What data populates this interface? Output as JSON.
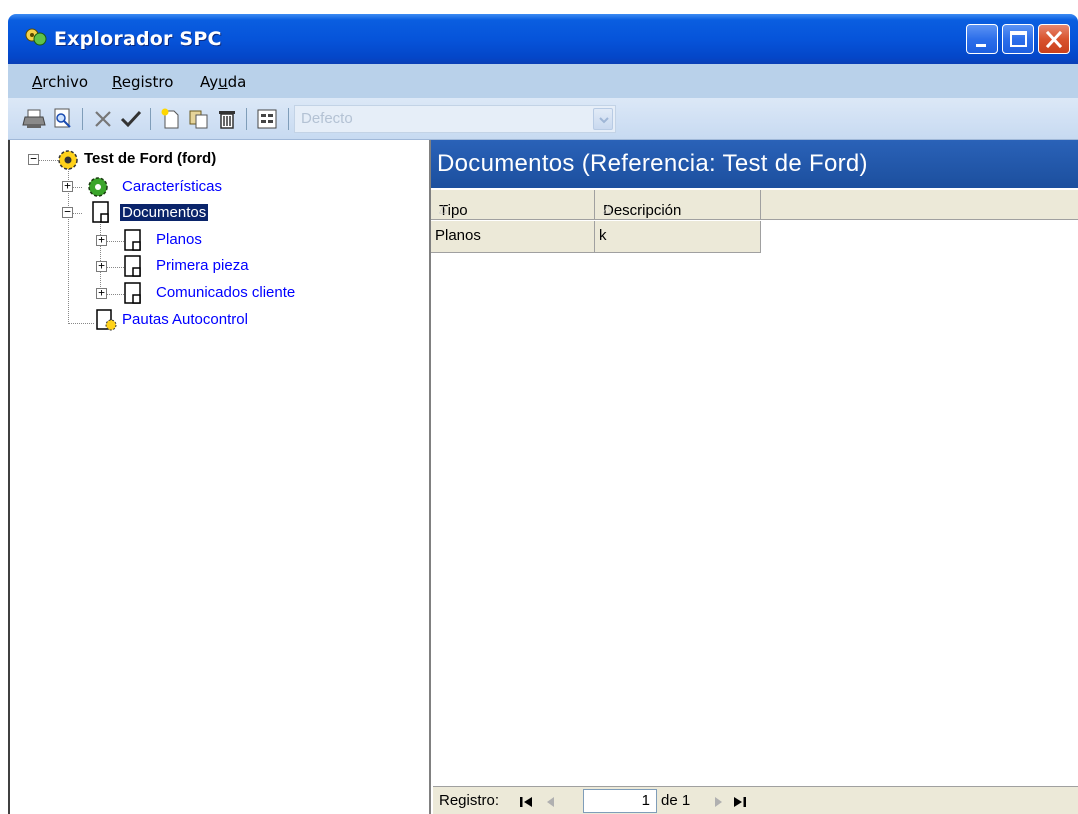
{
  "window": {
    "title": "Explorador SPC",
    "controls": [
      "minimize-icon",
      "maximize-icon",
      "close-icon"
    ]
  },
  "menu": {
    "items": [
      {
        "pre": "",
        "u": "A",
        "post": "rchivo"
      },
      {
        "pre": "",
        "u": "R",
        "post": "egistro"
      },
      {
        "pre": "Ay",
        "u": "u",
        "post": "da"
      }
    ]
  },
  "toolbar": {
    "buttons": [
      "print-icon",
      "print-preview-icon",
      "cancel-icon",
      "accept-icon",
      "new-icon",
      "copy-icon",
      "delete-icon",
      "form-view-icon"
    ],
    "combo": {
      "value": "Defecto"
    }
  },
  "tree": {
    "root": {
      "label": "Test de Ford (ford)"
    },
    "children": [
      {
        "label": "Características"
      },
      {
        "label": "Documentos"
      },
      {
        "label": "Planos"
      },
      {
        "label": "Primera pieza"
      },
      {
        "label": "Comunicados cliente"
      },
      {
        "label": "Pautas Autocontrol"
      }
    ]
  },
  "panel": {
    "title": "Documentos (Referencia: Test de Ford)"
  },
  "grid": {
    "columns": [
      "Tipo",
      "Descripción"
    ],
    "sort_glyph": "△",
    "rows": [
      [
        "Planos",
        "k"
      ]
    ]
  },
  "navigator": {
    "label": "Registro:",
    "current": "1",
    "of_text": "de 1"
  },
  "colors": {
    "title_bar": "#0654da",
    "menu_bar": "#b9d1ea",
    "panel_header": "#1c4f9e",
    "selection": "#0a246a",
    "tree_link": "#0000ff"
  }
}
